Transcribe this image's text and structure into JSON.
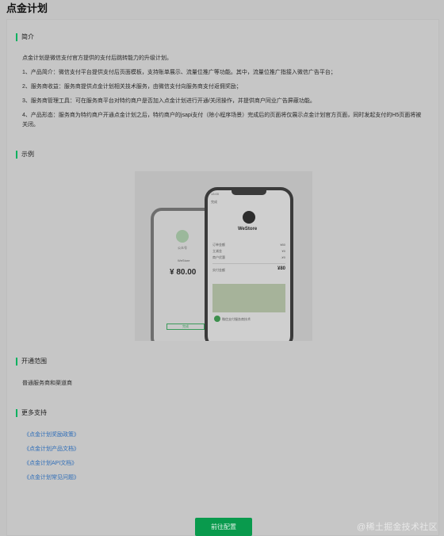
{
  "page": {
    "title": "点金计划"
  },
  "sections": {
    "intro": {
      "title": "简介",
      "lead": "点金计划是微信支付官方提供的支付后跳转能力的升级计划。",
      "items": [
        "1、产品简介：微信支付平台提供支付后页面模板，支持账单展示、流量位推广等功能。其中，流量位推广指接入微信广告平台；",
        "2、服务商收益：服务商提供点金计划相关技术服务，由微信支付向服务商支付返佣奖励；",
        "3、服务商管理工具：可在服务商平台对特约商户是否加入点金计划进行开通/关闭操作，并提供商户同业广告屏蔽功能。",
        "4、产品形态：服务商为特约商户开通点金计划之后，特约商户的jsapi支付（除小程序场景）完成后的页面将仅展示点金计划官方页面，同时发起支付的H5页面将被关闭。"
      ]
    },
    "example": {
      "title": "示例",
      "back_phone": {
        "brand_text": "公众号",
        "store": "WeStore",
        "amount": "¥ 80.00",
        "button": "完成"
      },
      "front_phone": {
        "status_time": "13:00",
        "back_label": "完成",
        "store": "WeStore",
        "rows": [
          {
            "label": "订单金额",
            "value": "¥80"
          },
          {
            "label": "立减金",
            "value": "¥0"
          },
          {
            "label": "商户优惠",
            "value": "-¥0"
          },
          {
            "label": "实付金额",
            "value": "¥80"
          }
        ],
        "ad_text": "微信支付服务商技术"
      }
    },
    "scope": {
      "title": "开通范围",
      "text": "普通服务商和渠道商"
    },
    "more": {
      "title": "更多支持",
      "links": [
        "《点金计划奖励政策》",
        "《点金计划产品文档》",
        "《点金计划API文档》",
        "《点金计划常见问题》"
      ]
    }
  },
  "actions": {
    "primary_label": "前往配置"
  },
  "watermark": "@稀土掘金技术社区",
  "colors": {
    "accent": "#07b15f",
    "link": "#2e6db8",
    "button": "#099a4d",
    "background": "#c3c3c3"
  }
}
